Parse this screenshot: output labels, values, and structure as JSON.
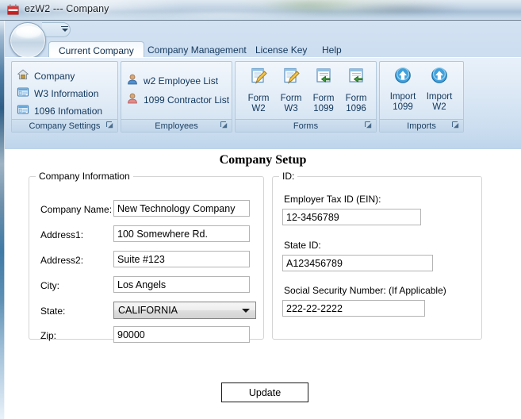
{
  "window": {
    "title": "ezW2 --- Company",
    "app_icon": "ezw2-app-icon"
  },
  "ribbon": {
    "quick_access": {
      "dropdown_icon": "chevron-down-icon",
      "orb_icon": "office-orb-icon"
    },
    "tabs": [
      {
        "label": "Current Company",
        "active": true
      },
      {
        "label": "Company Management",
        "active": false
      },
      {
        "label": "License Key",
        "active": false
      },
      {
        "label": "Help",
        "active": false
      }
    ],
    "groups": [
      {
        "name": "Company Settings",
        "footer_label": "Company Settings",
        "launcher_icon": "dialog-launcher-icon",
        "items": [
          {
            "label": "Company",
            "icon": "home-icon"
          },
          {
            "label": "W3 Information",
            "icon": "form-list-icon"
          },
          {
            "label": "1096 Infomation",
            "icon": "form-list-icon"
          }
        ]
      },
      {
        "name": "Employees",
        "footer_label": "Employees",
        "launcher_icon": "dialog-launcher-icon",
        "items": [
          {
            "label": "w2 Employee List",
            "icon": "person-blue-icon"
          },
          {
            "label": "1099 Contractor List",
            "icon": "person-red-icon"
          }
        ]
      },
      {
        "name": "Forms",
        "footer_label": "Forms",
        "launcher_icon": "dialog-launcher-icon",
        "items": [
          {
            "label_line1": "Form",
            "label_line2": "W2",
            "icon": "document-edit-icon"
          },
          {
            "label_line1": "Form",
            "label_line2": "W3",
            "icon": "document-edit-icon"
          },
          {
            "label_line1": "Form",
            "label_line2": "1099",
            "icon": "document-import-icon"
          },
          {
            "label_line1": "Form",
            "label_line2": "1096",
            "icon": "document-import-icon"
          }
        ]
      },
      {
        "name": "Imports",
        "footer_label": "Imports",
        "launcher_icon": "dialog-launcher-icon",
        "items": [
          {
            "label_line1": "Import",
            "label_line2": "1099",
            "icon": "upload-arrow-icon"
          },
          {
            "label_line1": "Import",
            "label_line2": "W2",
            "icon": "upload-arrow-icon"
          }
        ]
      }
    ]
  },
  "main": {
    "page_title": "Company Setup",
    "company_information": {
      "legend": "Company Information",
      "fields": [
        {
          "label": "Company Name:",
          "value": "New Technology Company",
          "type": "text"
        },
        {
          "label": "Address1:",
          "value": "100 Somewhere Rd.",
          "type": "text"
        },
        {
          "label": "Address2:",
          "value": "Suite #123",
          "type": "text"
        },
        {
          "label": "City:",
          "value": "Los Angels",
          "type": "text"
        },
        {
          "label": "State:",
          "value": "CALIFORNIA",
          "type": "combo"
        },
        {
          "label": "Zip:",
          "value": "90000",
          "type": "text"
        }
      ]
    },
    "id_section": {
      "legend": "ID:",
      "fields": [
        {
          "label": "Employer Tax ID (EIN):",
          "value": "12-3456789"
        },
        {
          "label": "State ID:",
          "value": "A123456789"
        },
        {
          "label": "Social Security Number: (If Applicable)",
          "value": "222-22-2222"
        }
      ]
    },
    "update_button": "Update"
  },
  "colors": {
    "ribbon_text": "#10365c",
    "tab_active_text": "#0f2e4d",
    "group_footer": "#1c4063",
    "titlebar_glass": "#b9cde0"
  }
}
